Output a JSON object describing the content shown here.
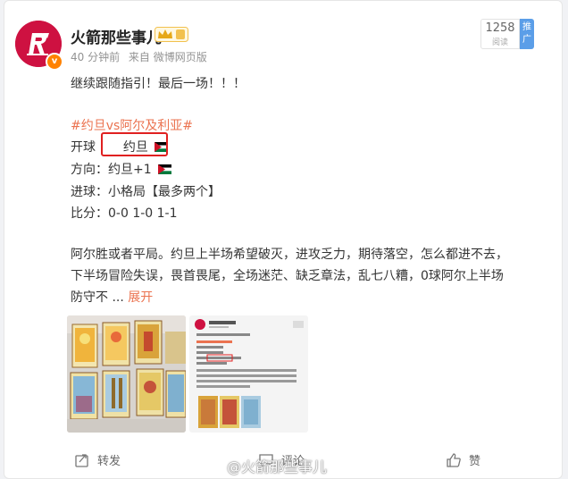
{
  "post": {
    "username": "火箭那些事儿",
    "time": "40 分钟前",
    "source": "来自 微博网页版",
    "read_count": "1258",
    "read_label": "阅读",
    "promote_label": "推广",
    "line1": "继续跟随指引！最后一场！！！",
    "topic": "#约旦vs阿尔及利亚#",
    "kickoff_label": "开球",
    "kickoff_value": "约旦",
    "direction_label": "方向：",
    "direction_value": "约旦+1",
    "goals": "进球：小格局【最多两个】",
    "score": "比分：0-0 1-0 1-1",
    "body1": "阿尔胜或者平局。约旦上半场希望破灭，进攻乏力，期待落空，怎么都进不去，",
    "body2": "下半场冒险失误，畏首畏尾，全场迷茫、缺乏章法，乱七八糟，0球阿尔上半场",
    "body3": "防守不 ...",
    "expand": "展开"
  },
  "actions": {
    "repost": "转发",
    "comment": "评论",
    "like": "赞"
  },
  "watermark": "@火箭那些事儿",
  "colors": {
    "accent": "#eb7350",
    "brand_red": "#ce1141",
    "highlight_box": "#e02020"
  }
}
